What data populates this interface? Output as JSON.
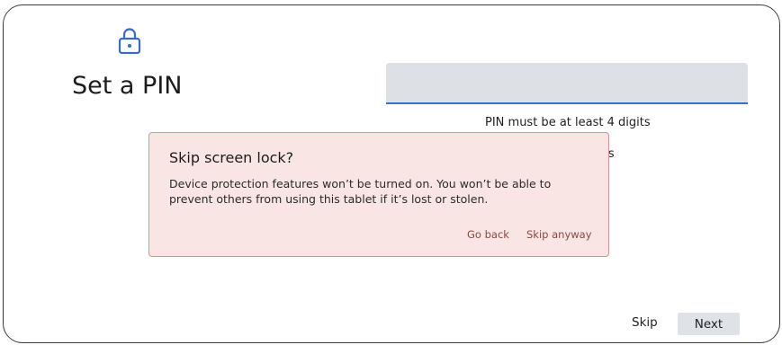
{
  "header": {
    "icon": "lock-icon",
    "title": "Set a PIN"
  },
  "pin_input": {
    "value": "",
    "hint": "PIN must be at least 4 digits",
    "underline_color": "#3a6cc2"
  },
  "background_text": {
    "options_fragment": "tions"
  },
  "dialog": {
    "title": "Skip screen lock?",
    "body": "Device protection features won’t be turned on. You won’t be able to prevent others from using this tablet if it’s lost or stolen.",
    "go_back_label": "Go back",
    "skip_anyway_label": "Skip anyway",
    "background_color": "#f8e5e4",
    "button_color": "#8a4a44"
  },
  "footer": {
    "skip_label": "Skip",
    "next_label": "Next"
  }
}
